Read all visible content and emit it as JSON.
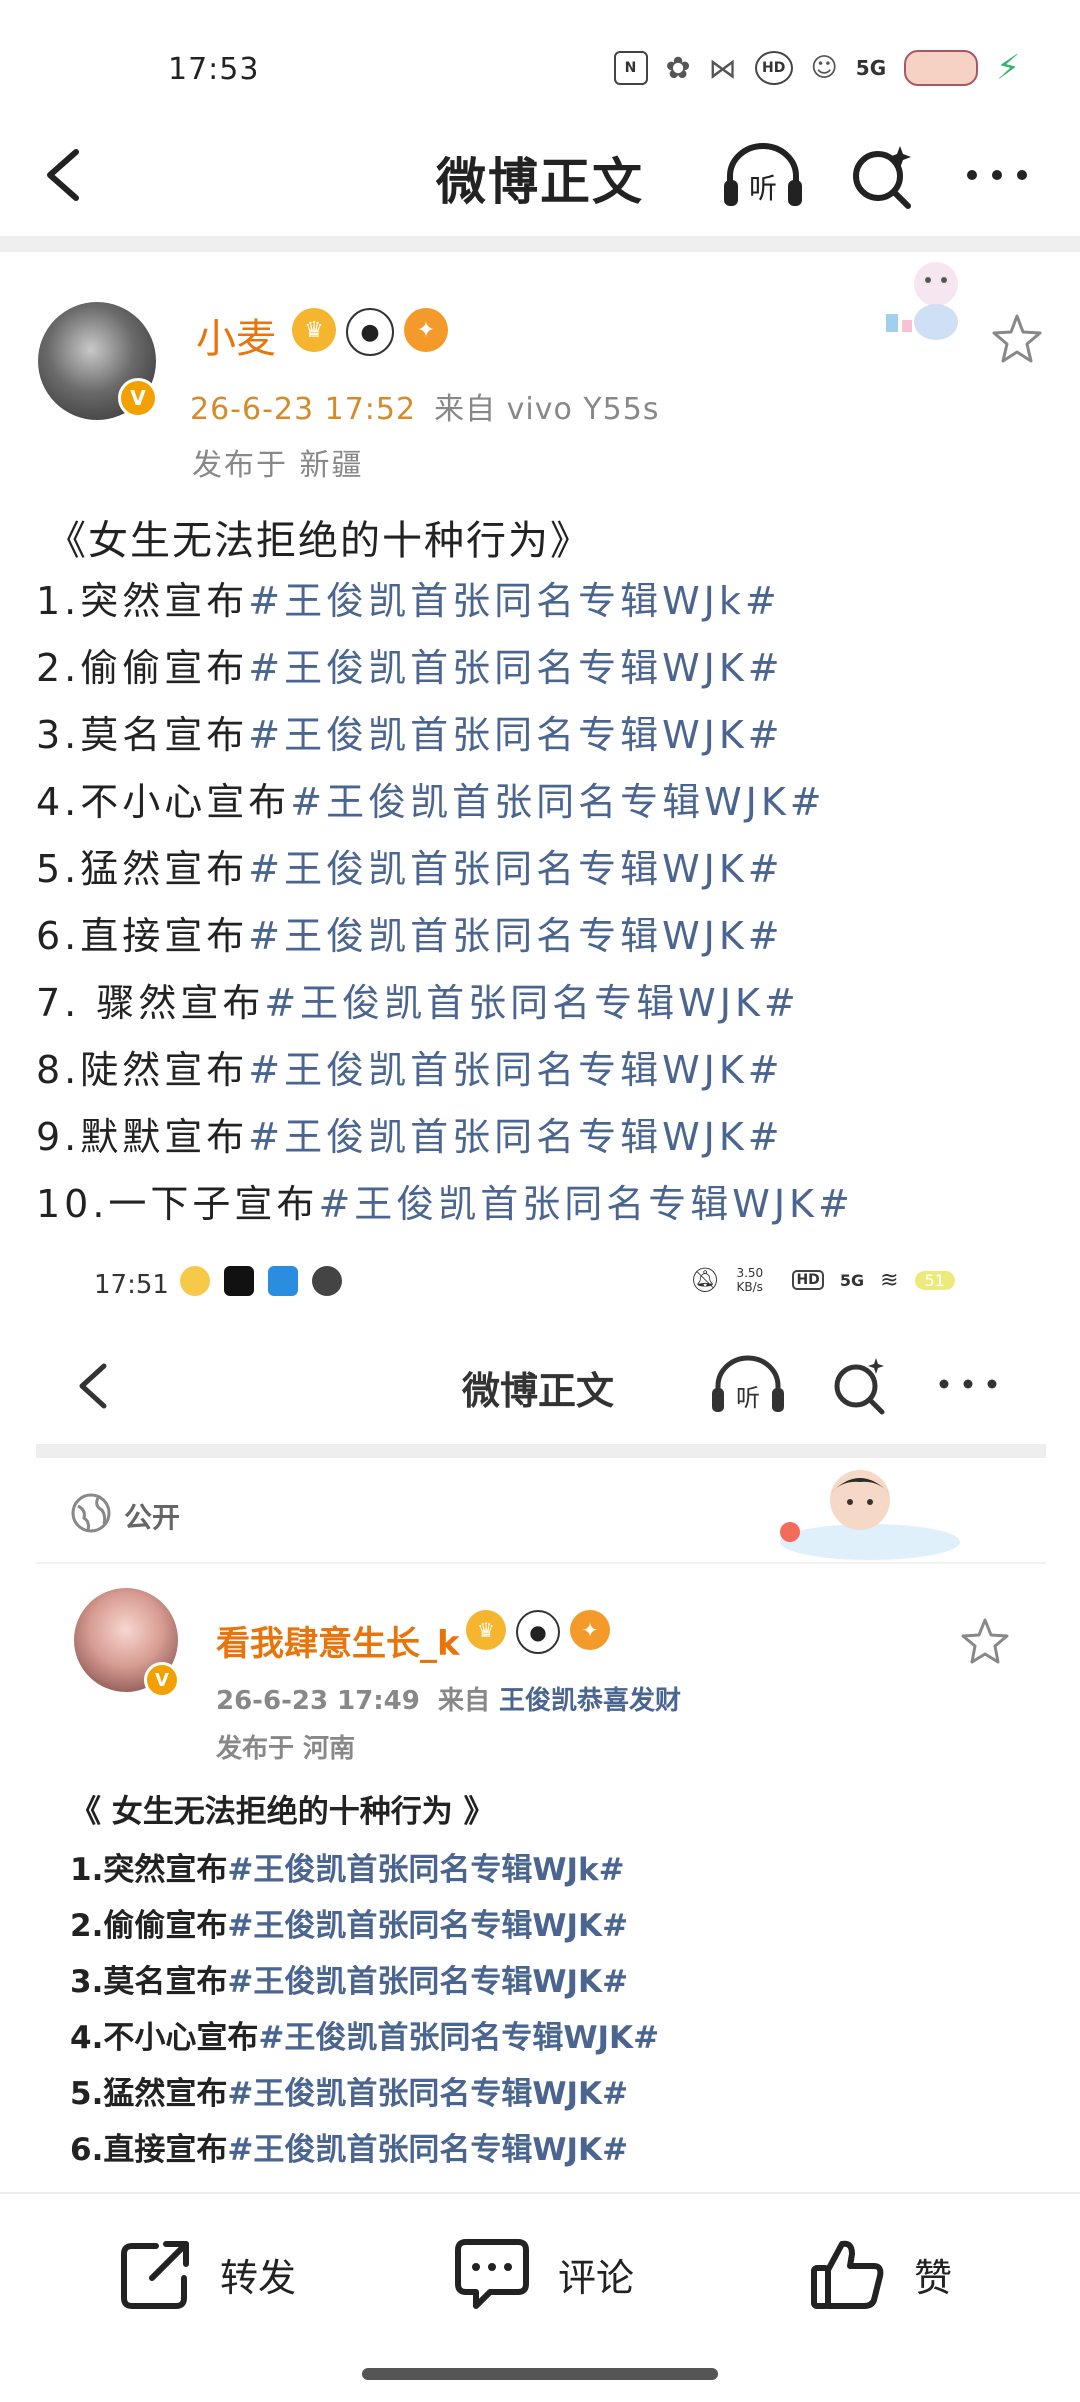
{
  "status_bar": {
    "time": "17:53",
    "nfc": "N",
    "hd": "HD",
    "network": "5G"
  },
  "header": {
    "title": "微博正文",
    "listen_label": "听"
  },
  "post": {
    "author": "小麦",
    "time": "26-6-23 17:52",
    "source": "来自 vivo Y55s",
    "location": "发布于 新疆",
    "title": "《女生无法拒绝的十种行为》",
    "lines": [
      {
        "prefix": "1.突然宣布",
        "tag": "#王俊凯首张同名专辑WJk#"
      },
      {
        "prefix": "2.偷偷宣布",
        "tag": "#王俊凯首张同名专辑WJK#"
      },
      {
        "prefix": "3.莫名宣布",
        "tag": "#王俊凯首张同名专辑WJK#"
      },
      {
        "prefix": "4.不小心宣布",
        "tag": "#王俊凯首张同名专辑WJK#"
      },
      {
        "prefix": "5.猛然宣布",
        "tag": "#王俊凯首张同名专辑WJK#"
      },
      {
        "prefix": "6.直接宣布",
        "tag": "#王俊凯首张同名专辑WJK#"
      },
      {
        "prefix": "7. 骤然宣布",
        "tag": "#王俊凯首张同名专辑WJK#"
      },
      {
        "prefix": "8.陡然宣布",
        "tag": "#王俊凯首张同名专辑WJK#"
      },
      {
        "prefix": "9.默默宣布",
        "tag": "#王俊凯首张同名专辑WJK#"
      },
      {
        "prefix": "10.一下子宣布",
        "tag": "#王俊凯首张同名专辑WJK#"
      }
    ]
  },
  "embedded": {
    "status_time": "17:51",
    "speed": "3.50 KB/s",
    "hd": "HD",
    "network": "5G",
    "battery": "51",
    "header_title": "微博正文",
    "listen_label": "听",
    "visibility": "公开",
    "author": "看我肆意生长_k",
    "time": "26-6-23 17:49",
    "source_prefix": "来自",
    "source_app": "王俊凯恭喜发财",
    "location": "发布于 河南",
    "title": "《 女生无法拒绝的十种行为 》",
    "lines": [
      {
        "prefix": "1.突然宣布",
        "tag": "#王俊凯首张同名专辑WJk#"
      },
      {
        "prefix": "2.偷偷宣布",
        "tag": "#王俊凯首张同名专辑WJK#"
      },
      {
        "prefix": "3.莫名宣布",
        "tag": "#王俊凯首张同名专辑WJK#"
      },
      {
        "prefix": "4.不小心宣布",
        "tag": "#王俊凯首张同名专辑WJK#"
      },
      {
        "prefix": "5.猛然宣布",
        "tag": "#王俊凯首张同名专辑WJK#"
      },
      {
        "prefix": "6.直接宣布",
        "tag": "#王俊凯首张同名专辑WJK#"
      }
    ]
  },
  "actions": {
    "forward": "转发",
    "comment": "评论",
    "like": "赞"
  },
  "colors": {
    "username": "#e8740c",
    "hashtag": "#4a6590",
    "meta_time": "#d68a2a"
  }
}
